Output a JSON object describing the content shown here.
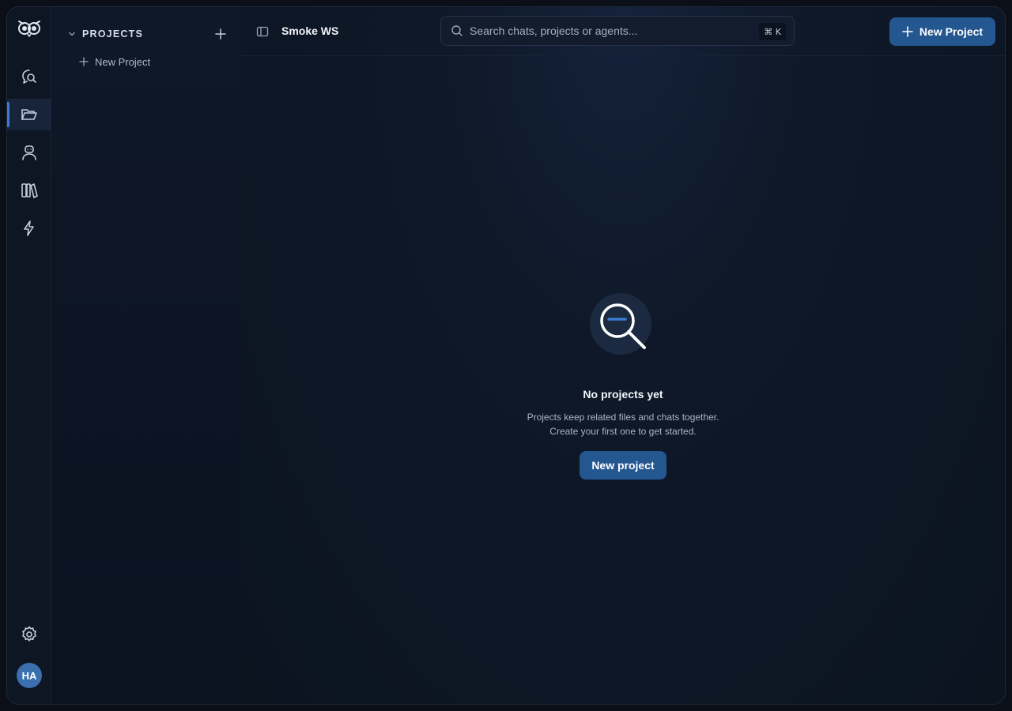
{
  "rail": {
    "logo": "owl-logo-icon",
    "items": [
      {
        "name": "chats",
        "icon": "chat-search-icon"
      },
      {
        "name": "projects",
        "icon": "folder-open-icon",
        "active": true
      },
      {
        "name": "agents",
        "icon": "robot-icon"
      },
      {
        "name": "library",
        "icon": "books-icon"
      },
      {
        "name": "automations",
        "icon": "lightning-icon"
      }
    ],
    "settings_icon": "gear-icon",
    "avatar_initials": "HA"
  },
  "sidebar": {
    "section_title": "PROJECTS",
    "new_project_label": "New Project"
  },
  "topbar": {
    "workspace_name": "Smoke WS",
    "search_placeholder": "Search chats, projects or agents...",
    "search_shortcut": "⌘ K",
    "new_project_button": "New Project"
  },
  "empty_state": {
    "title": "No projects yet",
    "line1": "Projects keep related files and chats together.",
    "line2": "Create your first one to get started.",
    "button": "New project"
  },
  "colors": {
    "accent": "#24568f",
    "rail_active_indicator": "#3b7ad0",
    "avatar_bg": "#3b6fb0"
  }
}
